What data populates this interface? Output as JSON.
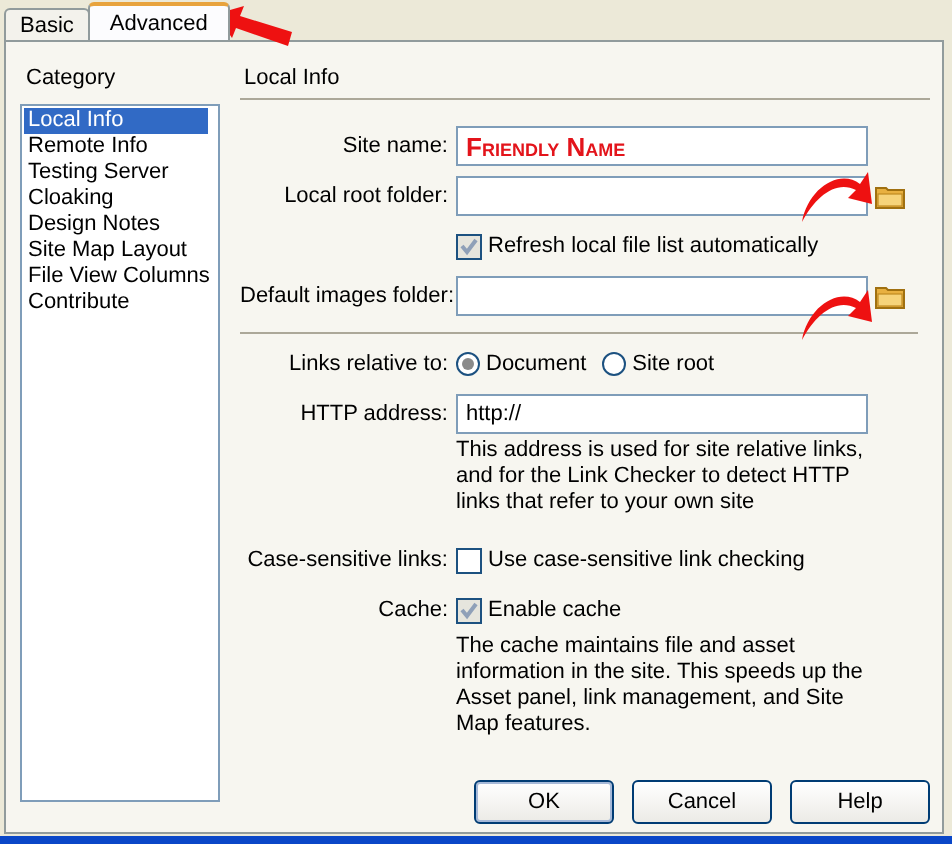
{
  "tabs": [
    {
      "label": "Basic",
      "selected": false
    },
    {
      "label": "Advanced",
      "selected": true
    }
  ],
  "category": {
    "title": "Category",
    "items": [
      {
        "label": "Local Info",
        "selected": true
      },
      {
        "label": "Remote Info",
        "selected": false
      },
      {
        "label": "Testing Server",
        "selected": false
      },
      {
        "label": "Cloaking",
        "selected": false
      },
      {
        "label": "Design Notes",
        "selected": false
      },
      {
        "label": "Site Map Layout",
        "selected": false
      },
      {
        "label": "File View Columns",
        "selected": false
      },
      {
        "label": "Contribute",
        "selected": false
      }
    ]
  },
  "section_title": "Local Info",
  "rows": [
    {
      "kind": "text",
      "label": "Site name:",
      "value": "Friendly Name",
      "highlight": true
    },
    {
      "kind": "folder",
      "label": "Local root folder:"
    },
    {
      "kind": "checkbox",
      "option": "Refresh local file list automatically",
      "checked": true
    },
    {
      "kind": "folder",
      "label": "Default images folder:"
    },
    {
      "kind": "separator"
    },
    {
      "kind": "radio",
      "label": "Links relative to:",
      "options": [
        {
          "label": "Document",
          "selected": true
        },
        {
          "label": "Site root",
          "selected": false
        }
      ]
    },
    {
      "kind": "text",
      "label": "HTTP address:",
      "value": "http://",
      "highlight": false
    },
    {
      "kind": "note",
      "text": "This address is used for site relative links, and for the Link Checker to detect HTTP links that refer to your own site"
    },
    {
      "kind": "checkbox",
      "label": "Case-sensitive links:",
      "option": "Use case-sensitive link checking",
      "checked": false
    },
    {
      "kind": "checkbox",
      "label": "Cache:",
      "option": "Enable cache",
      "checked": true
    },
    {
      "kind": "note",
      "text": "The cache maintains file and asset information in the site.  This speeds up the Asset panel, link management, and Site Map features."
    }
  ],
  "buttons": [
    "OK",
    "Cancel",
    "Help"
  ]
}
